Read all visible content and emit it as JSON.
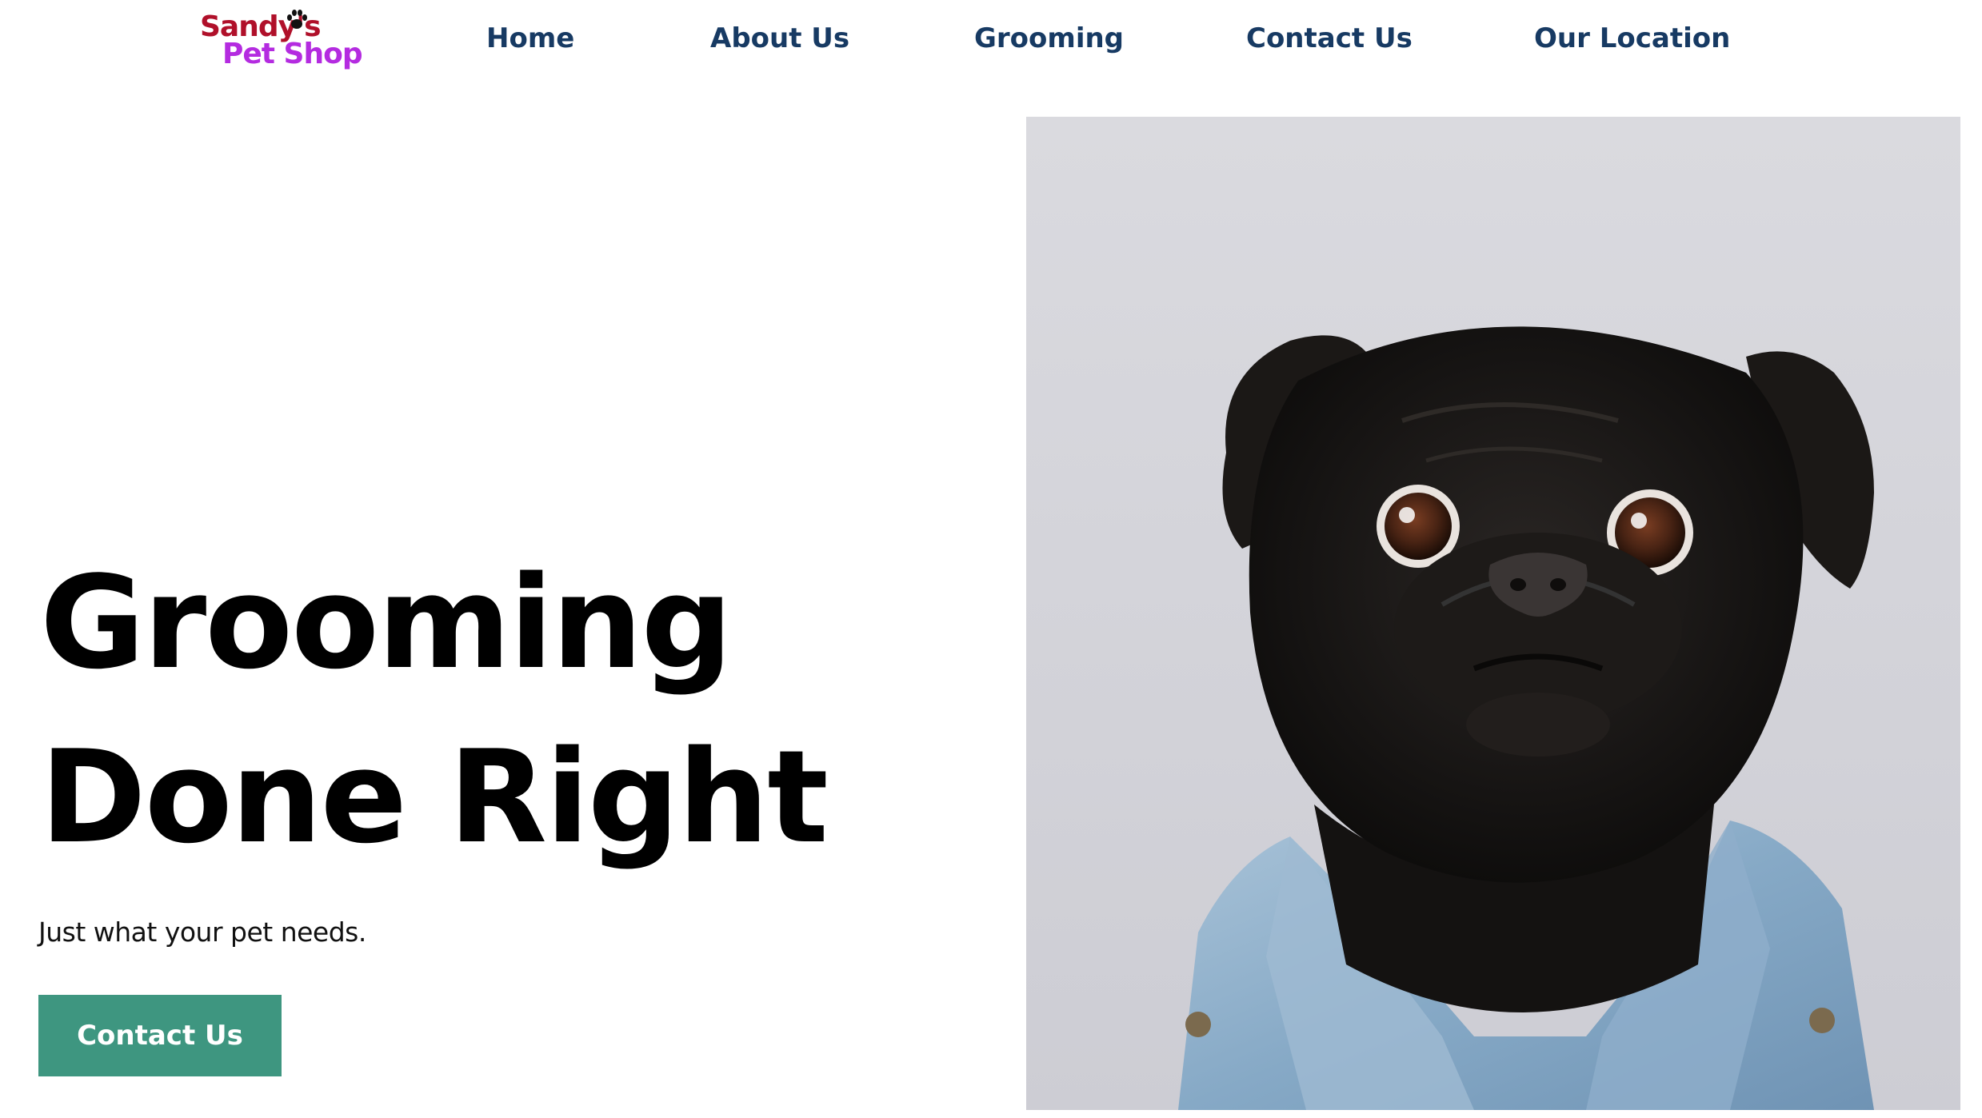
{
  "logo": {
    "line1": "Sandy's",
    "line2": "Pet Shop",
    "icon": "paw-icon",
    "colors": {
      "line1": "#b0102a",
      "line2": "#b42be0"
    }
  },
  "nav": {
    "items": [
      {
        "label": "Home"
      },
      {
        "label": "About Us"
      },
      {
        "label": "Grooming"
      },
      {
        "label": "Contact Us"
      },
      {
        "label": "Our Location"
      }
    ],
    "color": "#173a63"
  },
  "hero": {
    "title_line1": "Grooming",
    "title_line2": "Done Right",
    "subtitle": "Just what your pet needs.",
    "cta_label": "Contact Us",
    "cta_color": "#3e9680",
    "image": "pug-in-denim-jacket-photo"
  }
}
